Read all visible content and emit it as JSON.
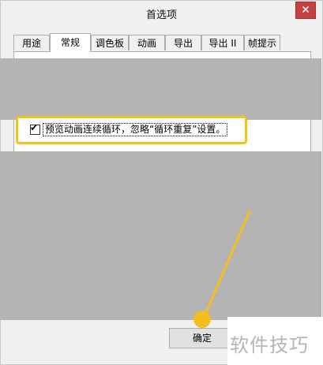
{
  "window": {
    "title": "首选项",
    "close_glyph": "✕"
  },
  "tabs": [
    {
      "label": "用途",
      "active": false
    },
    {
      "label": "常规",
      "active": true
    },
    {
      "label": "调色板",
      "active": false
    },
    {
      "label": "动画",
      "active": false
    },
    {
      "label": "导出",
      "active": false
    },
    {
      "label": "导出 II",
      "active": false
    },
    {
      "label": "帧提示",
      "active": false
    }
  ],
  "option": {
    "label": "预览动画连续循环，忽略“循环重复”设置。",
    "checked": true,
    "check_glyph": "✔"
  },
  "footer": {
    "ok_label": "确定"
  },
  "watermark": {
    "text": "软件技巧"
  },
  "colors": {
    "highlight": "#f0c419",
    "pointer": "#f2c01e"
  }
}
